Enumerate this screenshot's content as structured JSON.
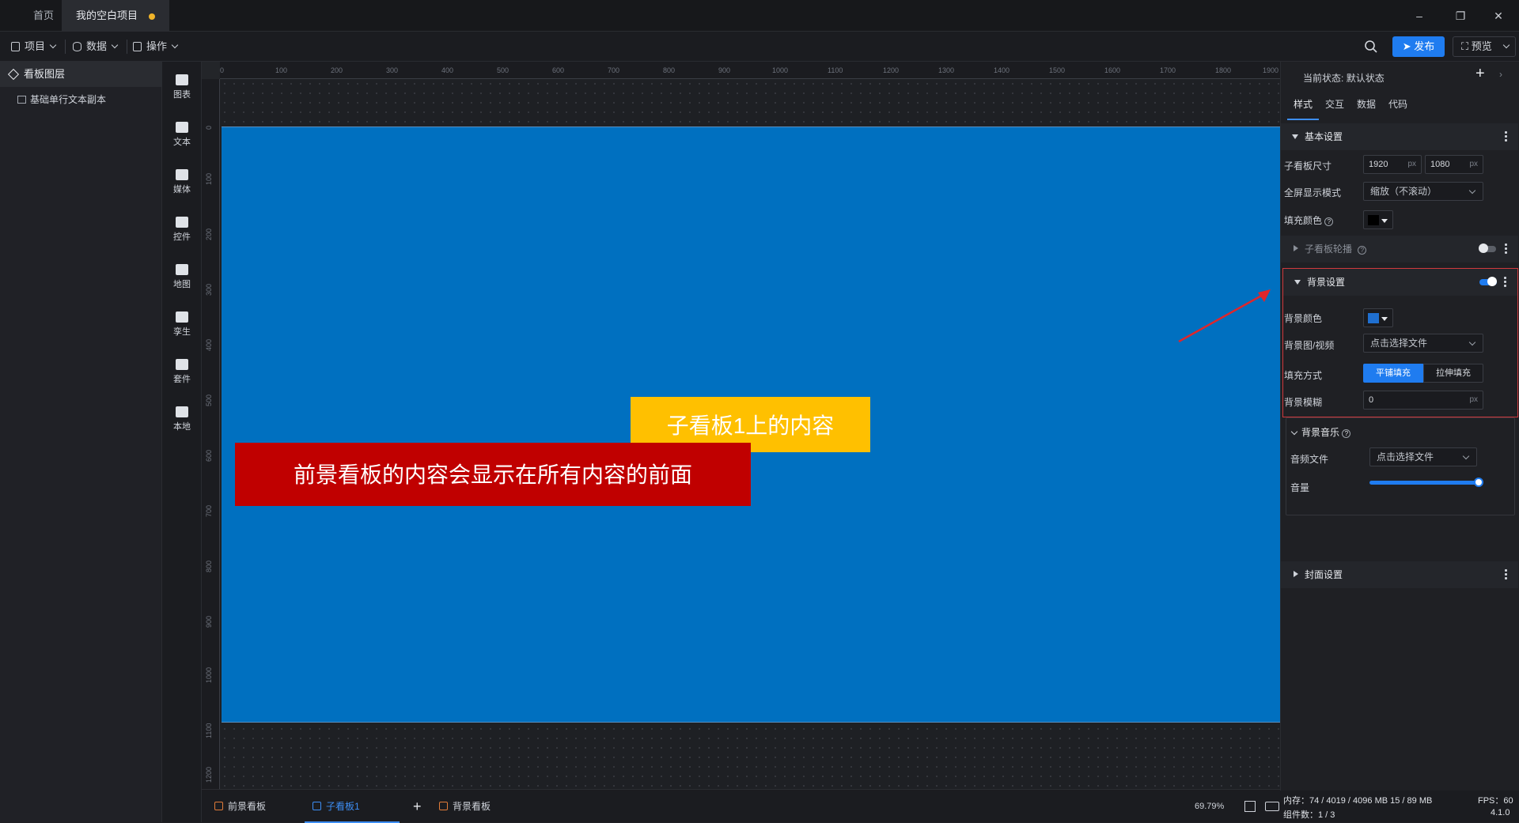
{
  "titlebar": {
    "tabs": [
      {
        "label": "首页"
      },
      {
        "label": "我的空白项目",
        "unsaved": true
      }
    ]
  },
  "menubar": {
    "items": [
      {
        "label": "项目"
      },
      {
        "label": "数据"
      },
      {
        "label": "操作"
      }
    ],
    "publish": "发布",
    "preview": "预览"
  },
  "layers": {
    "title": "看板图层",
    "items": [
      {
        "label": "基础单行文本副本"
      }
    ]
  },
  "toolbox": {
    "items": [
      {
        "label": "图表",
        "icon": "chart-icon"
      },
      {
        "label": "文本",
        "icon": "text-icon"
      },
      {
        "label": "媒体",
        "icon": "media-icon"
      },
      {
        "label": "控件",
        "icon": "widget-icon"
      },
      {
        "label": "地图",
        "icon": "map-icon"
      },
      {
        "label": "孪生",
        "icon": "twin-icon"
      },
      {
        "label": "套件",
        "icon": "kit-icon"
      },
      {
        "label": "本地",
        "icon": "local-icon"
      }
    ]
  },
  "ruler": {
    "top": [
      "0",
      "100",
      "200",
      "300",
      "400",
      "500",
      "600",
      "700",
      "800",
      "900",
      "1000",
      "1100",
      "1200",
      "1300",
      "1400",
      "1500",
      "1600",
      "1700",
      "1800",
      "1900"
    ],
    "left": [
      "0",
      "100",
      "200",
      "300",
      "400",
      "500",
      "600",
      "700",
      "800",
      "900",
      "1000",
      "1100",
      "1200"
    ]
  },
  "canvas": {
    "child_text": "子看板1上的内容",
    "front_text": "前景看板的内容会显示在所有内容的前面",
    "stage_color": "#0070c0"
  },
  "bottom": {
    "tabs": [
      {
        "label": "前景看板"
      },
      {
        "label": "子看板1",
        "active": true
      },
      {
        "label": "背景看板"
      }
    ],
    "add": "+",
    "zoom": "69.79%"
  },
  "panel": {
    "state_label": "当前状态:",
    "state_value": "默认状态",
    "tabs": [
      "样式",
      "交互",
      "数据",
      "代码"
    ],
    "basic": {
      "title": "基本设置",
      "size_label": "子看板尺寸",
      "width": "1920",
      "height": "1080",
      "unit": "px",
      "fullscreen_label": "全屏显示模式",
      "fullscreen_value": "缩放（不滚动）",
      "fill_label": "填充颜色",
      "fill_color": "#000000"
    },
    "carousel": {
      "title": "子看板轮播"
    },
    "background": {
      "title": "背景设置",
      "color_label": "背景颜色",
      "color": "#1f6fd0",
      "media_label": "背景图/视频",
      "media_placeholder": "点击选择文件",
      "fillmode_label": "填充方式",
      "fillmode_options": [
        "平铺填充",
        "拉伸填充"
      ],
      "fillmode_selected": "平铺填充",
      "blur_label": "背景模糊",
      "blur_value": "0",
      "blur_unit": "px"
    },
    "music": {
      "title": "背景音乐",
      "file_label": "音频文件",
      "file_placeholder": "点击选择文件",
      "volume_label": "音量",
      "volume": 1.0
    },
    "cover": {
      "title": "封面设置"
    }
  },
  "status": {
    "memory": "内存：74 / 4019 / 4096 MB 15 / 89 MB",
    "fps": "FPS：60",
    "components": "组件数：1 / 3",
    "version": "4.1.0"
  }
}
